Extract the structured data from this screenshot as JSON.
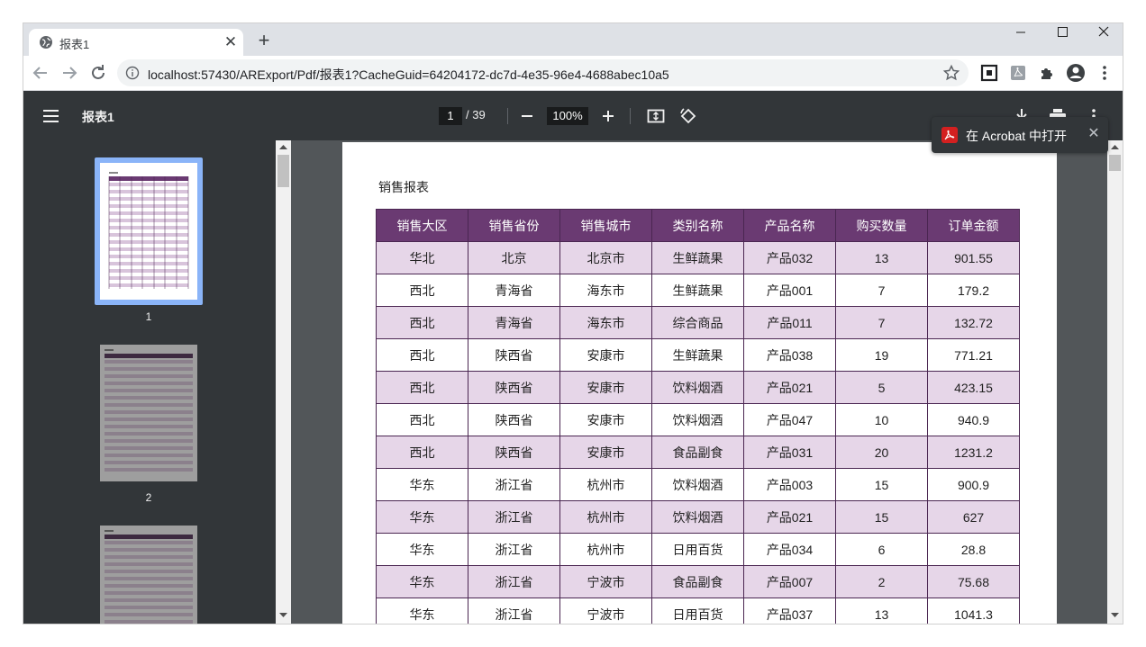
{
  "browser": {
    "tab_title": "报表1",
    "tab_close": "✕",
    "new_tab": "+",
    "url": "localhost:57430/ARExport/Pdf/报表1?CacheGuid=64204172-dc7d-4e35-96e4-4688abec10a5"
  },
  "viewer": {
    "doc_title": "报表1",
    "current_page": "1",
    "total_pages": "/ 39",
    "zoom": "100%",
    "thumbnails": [
      {
        "label": "1"
      },
      {
        "label": "2"
      }
    ]
  },
  "acrobat_prompt": {
    "text": "在 Acrobat 中打开",
    "close": "✕"
  },
  "report": {
    "title": "销售报表",
    "columns": [
      "销售大区",
      "销售省份",
      "销售城市",
      "类别名称",
      "产品名称",
      "购买数量",
      "订单金额"
    ],
    "rows": [
      [
        "华北",
        "北京",
        "北京市",
        "生鲜蔬果",
        "产品032",
        "13",
        "901.55"
      ],
      [
        "西北",
        "青海省",
        "海东市",
        "生鲜蔬果",
        "产品001",
        "7",
        "179.2"
      ],
      [
        "西北",
        "青海省",
        "海东市",
        "综合商品",
        "产品011",
        "7",
        "132.72"
      ],
      [
        "西北",
        "陕西省",
        "安康市",
        "生鲜蔬果",
        "产品038",
        "19",
        "771.21"
      ],
      [
        "西北",
        "陕西省",
        "安康市",
        "饮料烟酒",
        "产品021",
        "5",
        "423.15"
      ],
      [
        "西北",
        "陕西省",
        "安康市",
        "饮料烟酒",
        "产品047",
        "10",
        "940.9"
      ],
      [
        "西北",
        "陕西省",
        "安康市",
        "食品副食",
        "产品031",
        "20",
        "1231.2"
      ],
      [
        "华东",
        "浙江省",
        "杭州市",
        "饮料烟酒",
        "产品003",
        "15",
        "900.9"
      ],
      [
        "华东",
        "浙江省",
        "杭州市",
        "饮料烟酒",
        "产品021",
        "15",
        "627"
      ],
      [
        "华东",
        "浙江省",
        "杭州市",
        "日用百货",
        "产品034",
        "6",
        "28.8"
      ],
      [
        "华东",
        "浙江省",
        "宁波市",
        "食品副食",
        "产品007",
        "2",
        "75.68"
      ],
      [
        "华东",
        "浙江省",
        "宁波市",
        "日用百货",
        "产品037",
        "13",
        "1041.3"
      ]
    ]
  },
  "colors": {
    "header_bg": "#6a3a72",
    "row_alt_bg": "#e6d6e8",
    "viewer_bar": "#323639",
    "viewer_bg": "#525659"
  }
}
